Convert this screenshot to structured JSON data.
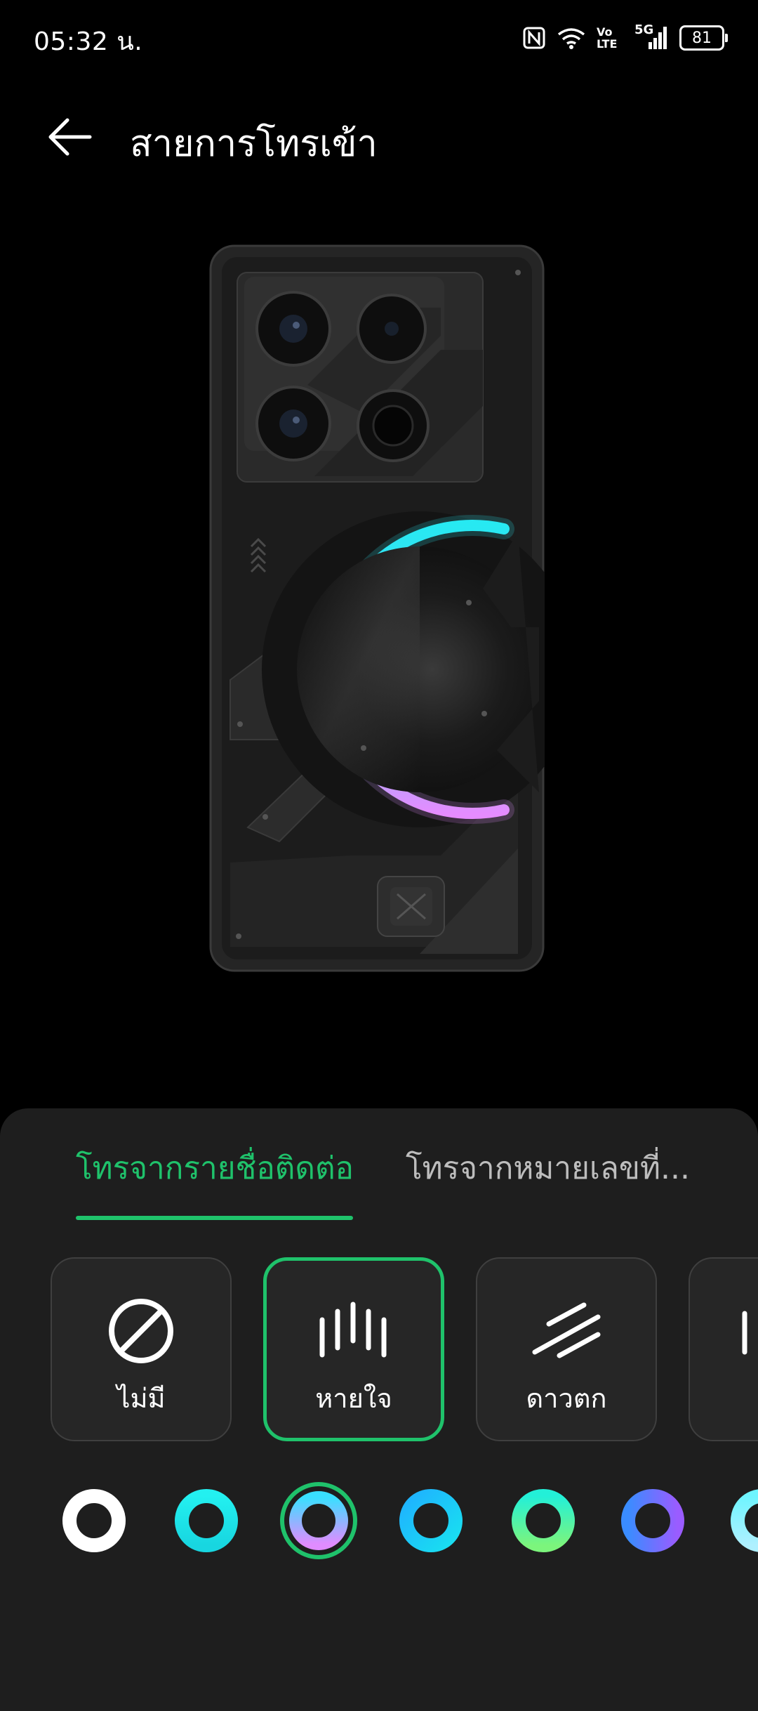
{
  "status_bar": {
    "time": "05:32 น.",
    "network_label": "5G",
    "volte_label": "Vo LTE",
    "battery_level": "81"
  },
  "header": {
    "title": "สายการโทรเข้า"
  },
  "tabs": [
    {
      "label": "โทรจากรายชื่อติดต่อ",
      "selected": true
    },
    {
      "label": "โทรจากหมายเลขที่...",
      "selected": false
    }
  ],
  "effects": [
    {
      "label": "ไม่มี",
      "icon": "none-icon",
      "selected": false
    },
    {
      "label": "หายใจ",
      "icon": "breathing-icon",
      "selected": true
    },
    {
      "label": "ดาวตก",
      "icon": "meteor-icon",
      "selected": false
    },
    {
      "label": "",
      "icon": "partial-effect-icon",
      "selected": false
    }
  ],
  "colors": [
    {
      "name": "white",
      "from": "#ffffff",
      "to": "#ffffff",
      "selected": false
    },
    {
      "name": "cyan",
      "from": "#23f0f0",
      "to": "#18d6e0",
      "selected": false
    },
    {
      "name": "cyan-purple",
      "from": "#39e0ff",
      "to": "#e08cff",
      "selected": true
    },
    {
      "name": "blue",
      "from": "#1fb2ff",
      "to": "#19e0f0",
      "selected": false
    },
    {
      "name": "teal-green",
      "from": "#23f0d8",
      "to": "#7cf57c",
      "selected": false
    },
    {
      "name": "blue-violet",
      "from": "#3a8cff",
      "to": "#9a5cff",
      "selected": false
    },
    {
      "name": "cyan-partial",
      "from": "#6ff5ff",
      "to": "#aef0ff",
      "selected": false
    }
  ],
  "theme": {
    "accent": "#1fc26b",
    "panel_bg": "#1e1e1e",
    "ring_cyan": "#27e9f2",
    "ring_pink": "#e58cff"
  }
}
